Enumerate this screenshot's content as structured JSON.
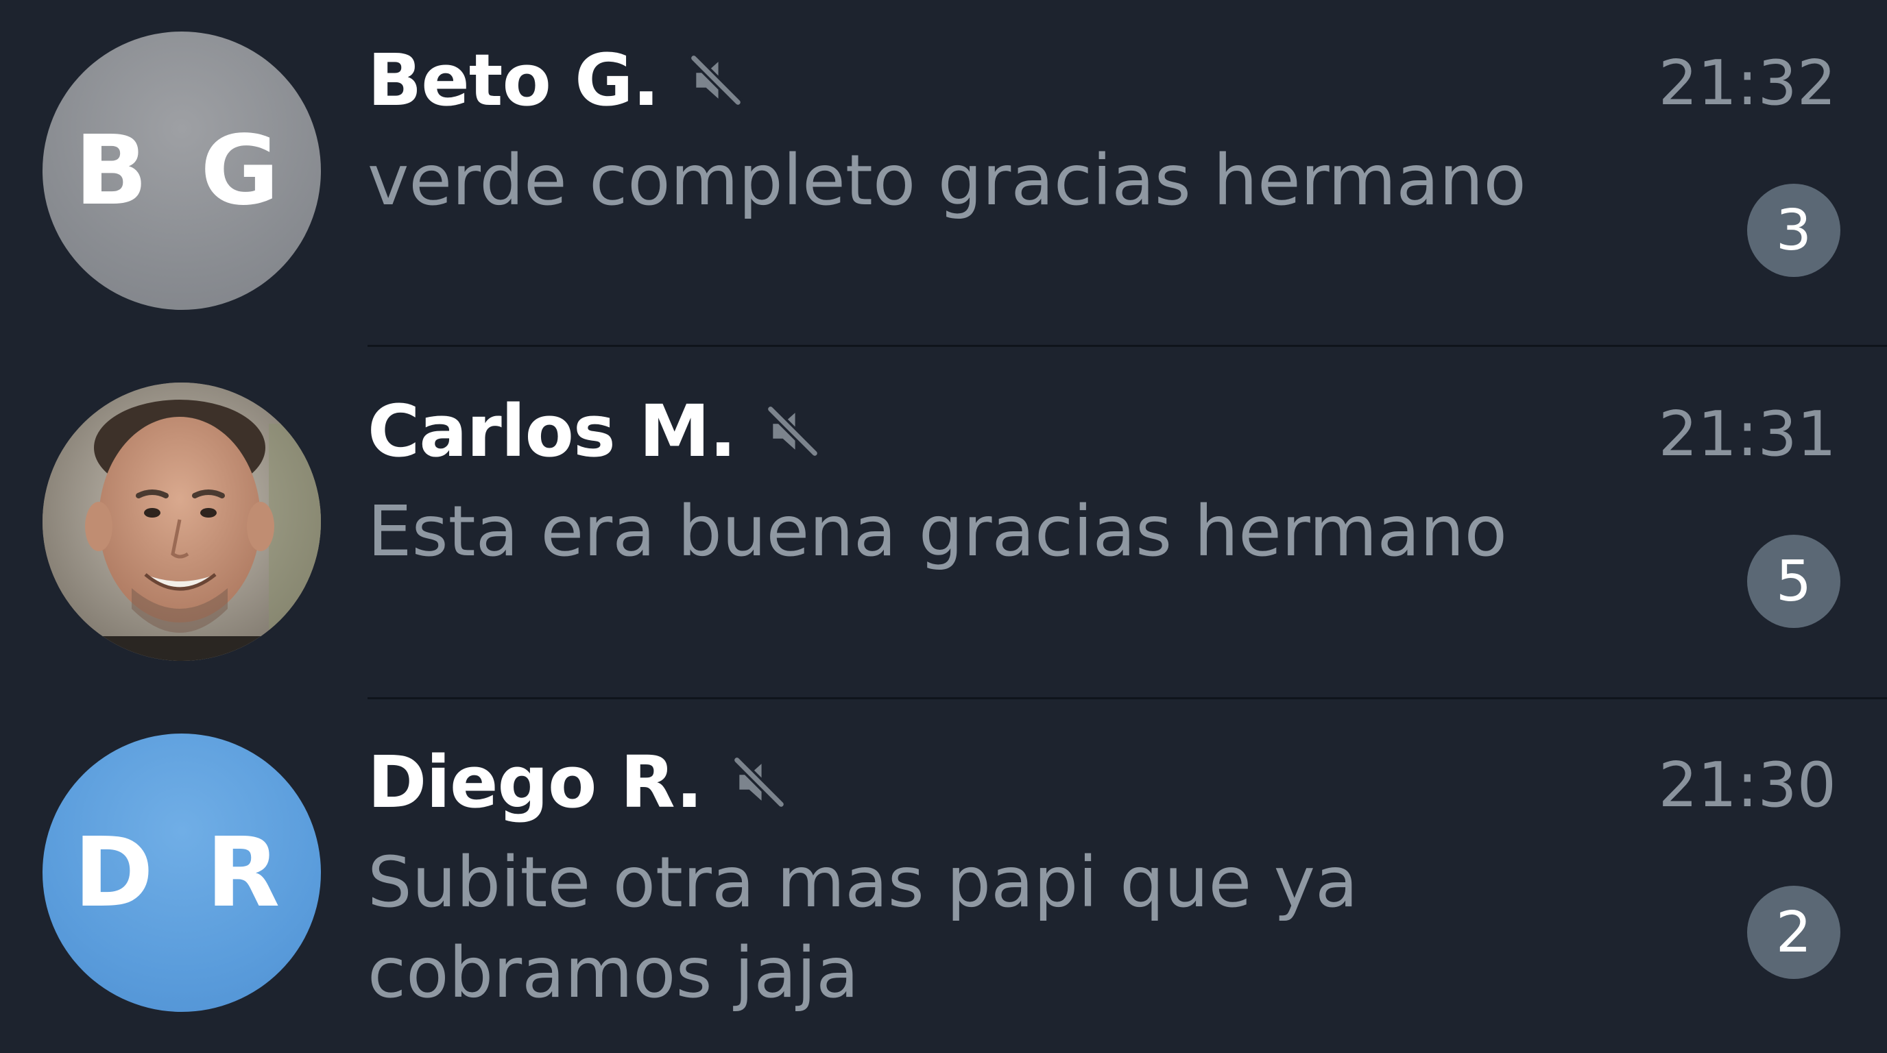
{
  "chats": [
    {
      "name": "Beto G.",
      "initials": "B G",
      "time": "21:32",
      "preview": "verde completo gracias hermano",
      "unread": "3",
      "muted": true,
      "avatar_color": "#8a8d92"
    },
    {
      "name": "Carlos M.",
      "initials": "",
      "time": "21:31",
      "preview": "Esta era buena gracias hermano",
      "unread": "5",
      "muted": true,
      "avatar_type": "photo"
    },
    {
      "name": "Diego R.",
      "initials": "D R",
      "time": "21:30",
      "preview": "Subite otra mas papi que ya cobramos jaja",
      "unread": "2",
      "muted": true,
      "avatar_color": "#5b9ddc"
    }
  ],
  "icons": {
    "mute": "speaker-muted-icon"
  },
  "colors": {
    "background": "#1d232e",
    "name": "#ffffff",
    "preview": "#8f98a2",
    "time": "#8a939d",
    "badge": "#5b6875"
  }
}
